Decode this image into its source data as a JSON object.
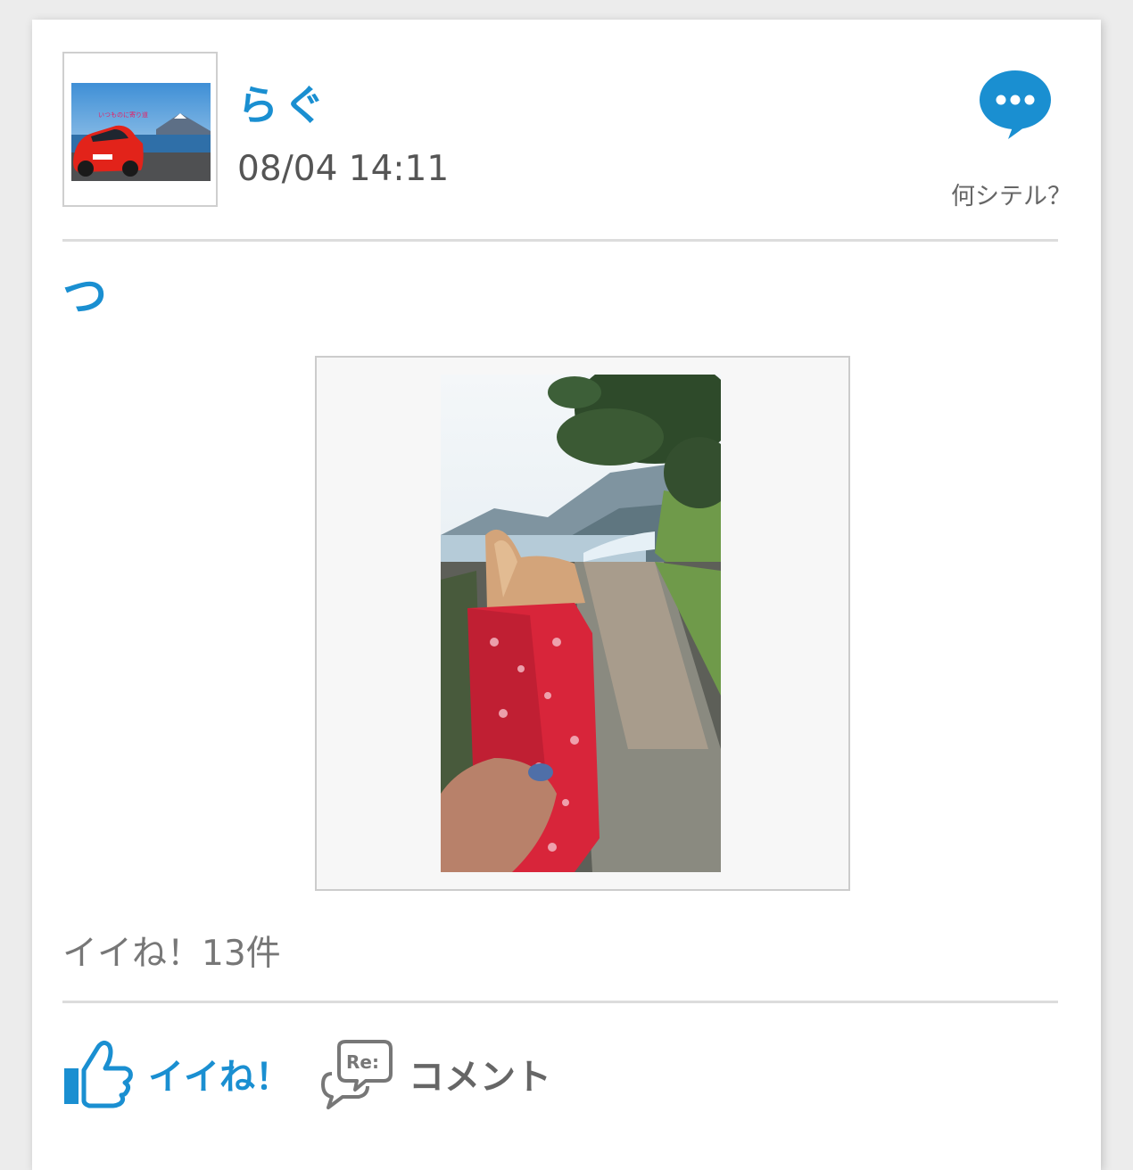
{
  "post": {
    "username": "らぐ",
    "timestamp": "08/04 14:11",
    "status_prompt": "何シテル？",
    "title": "つ",
    "likes_text": "イイね！13件"
  },
  "avatar": {
    "caption": "いつものに寄り道"
  },
  "actions": {
    "like_label": "イイね！",
    "comment_label": "コメント",
    "comment_badge": "Re:"
  },
  "colors": {
    "accent": "#1a8fd1",
    "muted_text": "#777777",
    "divider": "#dcdcdc"
  },
  "icons": {
    "status": "speech-bubble-icon",
    "like": "thumbs-up-icon",
    "comment": "re-comment-bubble-icon"
  }
}
